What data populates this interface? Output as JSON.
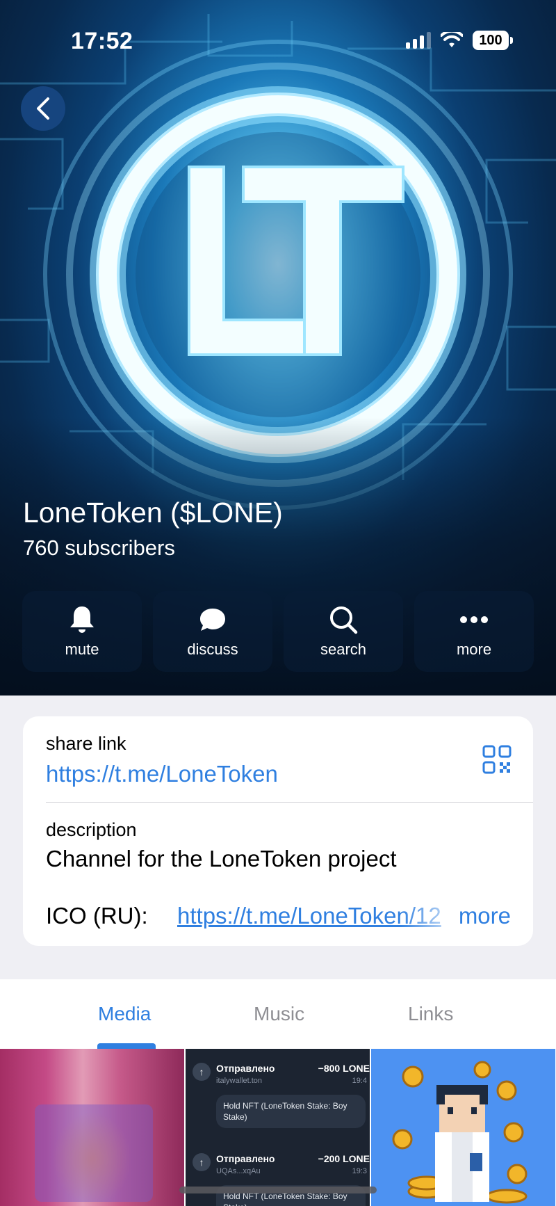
{
  "status_bar": {
    "time": "17:52",
    "battery": "100"
  },
  "channel": {
    "title": "LoneToken ($LONE)",
    "subscribers": "760 subscribers"
  },
  "actions": [
    {
      "label": "mute",
      "icon": "bell-icon"
    },
    {
      "label": "discuss",
      "icon": "chat-bubble-icon"
    },
    {
      "label": "search",
      "icon": "search-icon"
    },
    {
      "label": "more",
      "icon": "ellipsis-icon"
    }
  ],
  "info": {
    "share_label": "share link",
    "share_url": "https://t.me/LoneToken",
    "description_label": "description",
    "description": "Channel for the LoneToken project",
    "ico_prefix": "ICO (RU):",
    "ico_link": "https://t.me/LoneToken/12",
    "more": "more"
  },
  "tabs": [
    {
      "label": "Media",
      "active": true
    },
    {
      "label": "Music",
      "active": false
    },
    {
      "label": "Links",
      "active": false
    }
  ],
  "media": {
    "tx": [
      {
        "title": "Отправлено",
        "amount": "−800 LONE",
        "from": "italywallet.ton",
        "time": "19:4",
        "note": "Hold NFT (LoneToken Stake: Boy Stake)"
      },
      {
        "title": "Отправлено",
        "amount": "−200 LONE",
        "from": "UQAs...xqAu",
        "time": "19:3",
        "note": "Hold NFT (LoneToken Stake: Boy Stake)"
      }
    ]
  },
  "colors": {
    "accent": "#2f7fe0",
    "hero_dark": "#06182e",
    "glow": "#5fc6f0"
  }
}
